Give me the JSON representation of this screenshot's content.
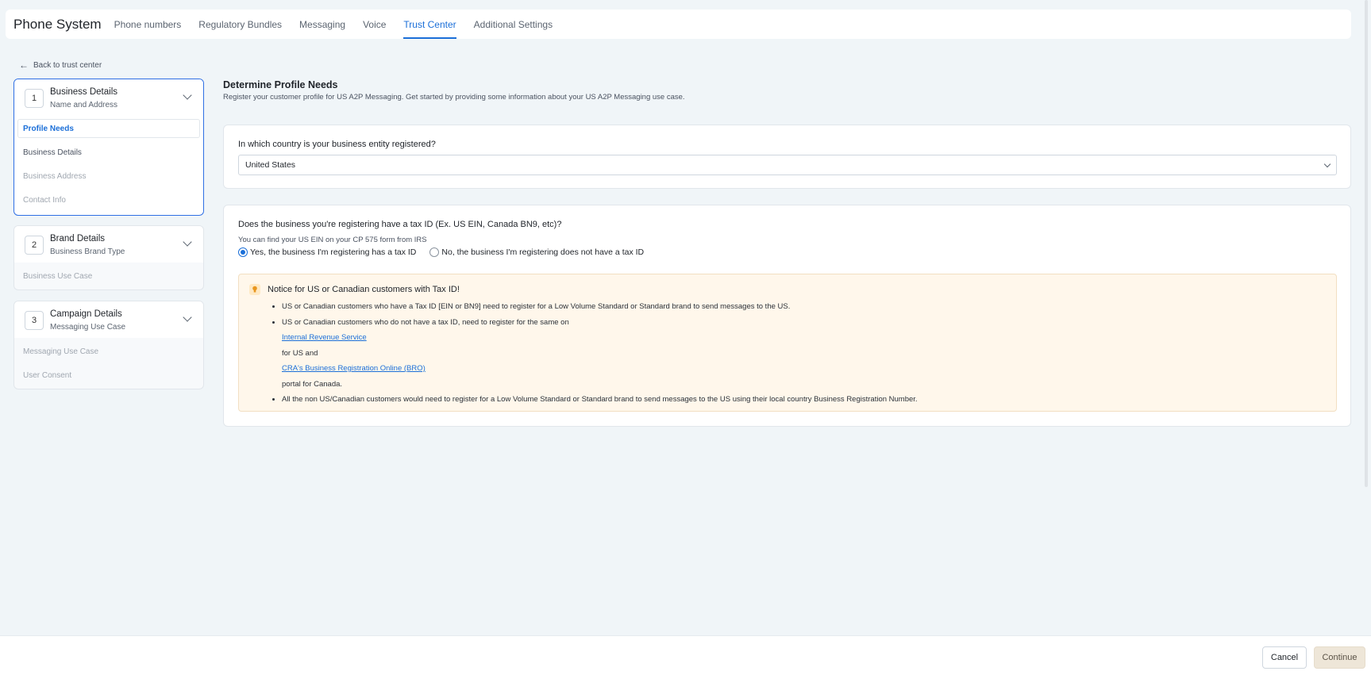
{
  "header": {
    "app_title": "Phone System",
    "tabs": [
      {
        "label": "Phone numbers"
      },
      {
        "label": "Regulatory Bundles"
      },
      {
        "label": "Messaging"
      },
      {
        "label": "Voice"
      },
      {
        "label": "Trust Center",
        "active": true
      },
      {
        "label": "Additional Settings"
      }
    ]
  },
  "back_link": "Back to trust center",
  "steps": [
    {
      "number": "1",
      "title": "Business Details",
      "subtitle": "Name and Address",
      "items": [
        "Profile Needs",
        "Business Details",
        "Business Address",
        "Contact Info"
      ]
    },
    {
      "number": "2",
      "title": "Brand Details",
      "subtitle": "Business Brand Type",
      "items": [
        "Business Use Case"
      ]
    },
    {
      "number": "3",
      "title": "Campaign Details",
      "subtitle": "Messaging Use Case",
      "items": [
        "Messaging Use Case",
        "User Consent"
      ]
    }
  ],
  "main": {
    "title": "Determine Profile Needs",
    "description": "Register your customer profile for US A2P Messaging. Get started by providing some information about your US A2P Messaging use case."
  },
  "country_question": {
    "label": "In which country is your business entity registered?",
    "value": "United States"
  },
  "tax_question": {
    "label": "Does the business you're registering have a tax ID (Ex. US EIN, Canada BN9, etc)?",
    "hint": "You can find your US EIN on your CP 575 form from IRS",
    "option_yes": "Yes, the business I'm registering has a tax ID",
    "option_no": "No, the business I'm registering does not have a tax ID",
    "selected": "yes"
  },
  "notice": {
    "title": "Notice for US or Canadian customers with Tax ID!",
    "bullet1": "US or Canadian customers who have a Tax ID [EIN or BN9] need to register for a Low Volume Standard or Standard brand to send messages to the US.",
    "bullet2_pre": "US or Canadian customers who do not have a tax ID, need to register for the same on",
    "link_irs": "Internal Revenue Service",
    "bullet2_mid": "for US and",
    "link_cra": "CRA's Business Registration Online (BRO)",
    "bullet2_post": "portal for Canada.",
    "bullet3": "All the non US/Canadian customers would need to register for a Low Volume Standard or Standard brand to send messages to the US using their local country Business Registration Number."
  },
  "footer": {
    "cancel": "Cancel",
    "continue": "Continue"
  },
  "colors": {
    "accent": "#1b6fd8",
    "notice_bg": "#fff7eb",
    "page_bg": "#f0f5f8"
  }
}
